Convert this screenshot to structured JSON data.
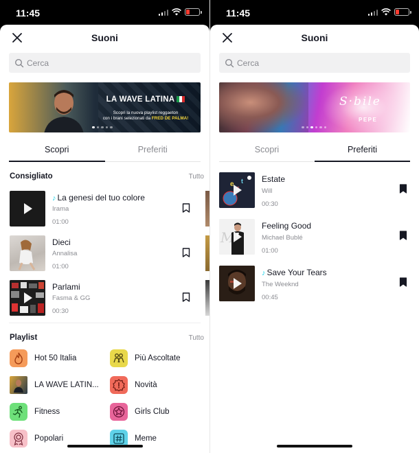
{
  "status": {
    "time": "11:45"
  },
  "sheet": {
    "title": "Suoni"
  },
  "search": {
    "placeholder": "Cerca"
  },
  "banner_left": {
    "title": "LA WAVE LATINA",
    "subtitle_line1": "Scopri la nuova playlist reggaeton",
    "subtitle_line2_prefix": "con i brani selezionati da ",
    "subtitle_line2_highlight": "FRED DE PALMA!"
  },
  "banner_right": {
    "signature": "S·bile",
    "artist": "PEPE"
  },
  "tabs": {
    "discover": "Scopri",
    "favorites": "Preferiti"
  },
  "recommended": {
    "title": "Consigliato",
    "more": "Tutto",
    "tracks": [
      {
        "name": "La genesi del tuo colore",
        "artist": "Irama",
        "duration": "01:00",
        "original_sound": true
      },
      {
        "name": "Dieci",
        "artist": "Annalisa",
        "duration": "01:00",
        "original_sound": false
      },
      {
        "name": "Parlami",
        "artist": "Fasma & GG",
        "duration": "00:30",
        "original_sound": false
      }
    ]
  },
  "playlists": {
    "title": "Playlist",
    "more": "Tutto",
    "items": [
      {
        "label": "Hot 50 Italia",
        "icon": "flame-icon"
      },
      {
        "label": "Più Ascoltate",
        "icon": "people-icon"
      },
      {
        "label": "LA WAVE LATIN...",
        "icon": "cover-icon"
      },
      {
        "label": "Novità",
        "icon": "alert-badge-icon"
      },
      {
        "label": "Fitness",
        "icon": "runner-icon"
      },
      {
        "label": "Girls Club",
        "icon": "star-badge-icon"
      },
      {
        "label": "Popolari",
        "icon": "rosette-icon"
      },
      {
        "label": "Meme",
        "icon": "hashtag-icon"
      }
    ]
  },
  "favorites": {
    "tracks": [
      {
        "name": "Estate",
        "artist": "Will",
        "duration": "00:30",
        "original_sound": false
      },
      {
        "name": "Feeling Good",
        "artist": "Michael Bublé",
        "duration": "01:00",
        "original_sound": false
      },
      {
        "name": "Save Your Tears",
        "artist": "The Weeknd",
        "duration": "00:45",
        "original_sound": true
      }
    ]
  },
  "colors": {
    "accent_note": "#20d5ec",
    "text": "#161823",
    "muted": "#8a8b91"
  }
}
